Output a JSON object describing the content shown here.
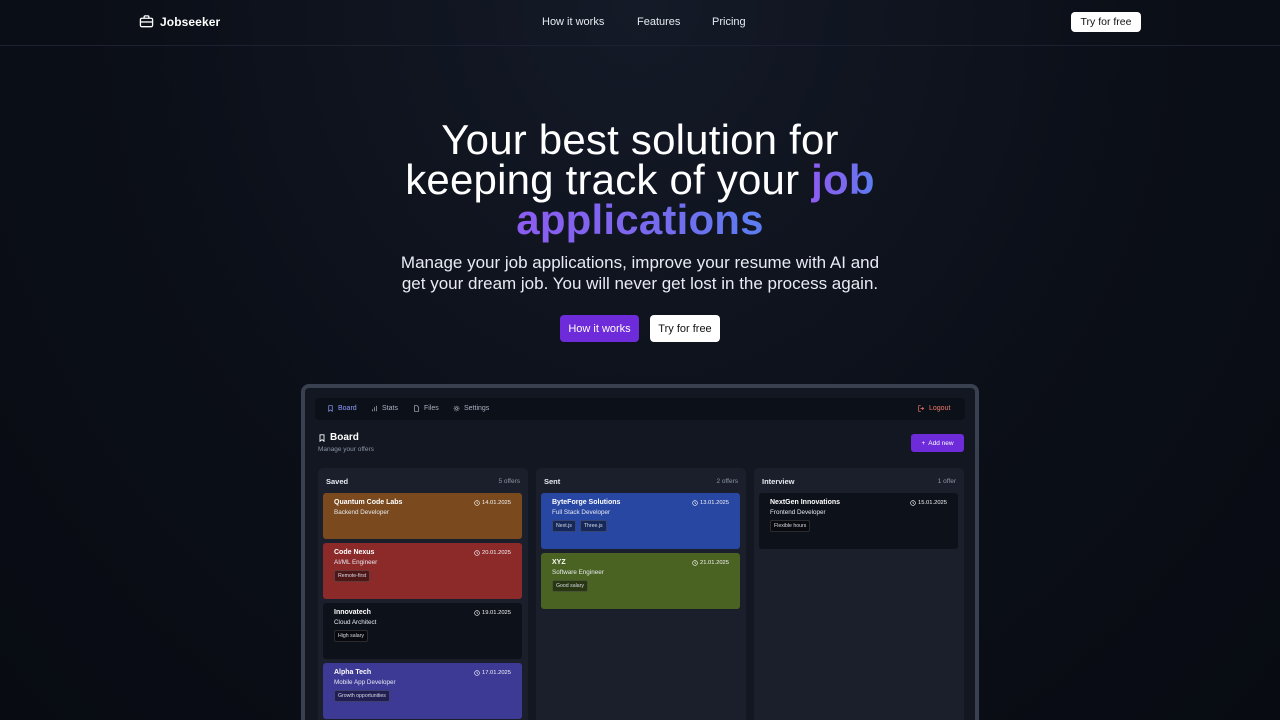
{
  "nav": {
    "brand": "Jobseeker",
    "links": [
      "How it works",
      "Features",
      "Pricing"
    ],
    "cta": "Try for free"
  },
  "hero": {
    "title_line1": "Your best solution for",
    "title_line2_plain": "keeping track of your",
    "title_line2_accent": "job",
    "title_line3_accent": "applications",
    "subtitle_line1": "Manage your job applications, improve your resume with AI and",
    "subtitle_line2": "get your dream job. You will never get lost in the process again.",
    "primary_cta": "How it works",
    "secondary_cta": "Try for free"
  },
  "app": {
    "tabs": [
      "Board",
      "Stats",
      "Files",
      "Settings"
    ],
    "logout": "Logout",
    "board_title": "Board",
    "board_subtitle": "Manage your offers",
    "add_button": "Add new",
    "columns": [
      {
        "title": "Saved",
        "count": "5 offers",
        "cards": [
          {
            "company": "Quantum Code Labs",
            "role": "Backend Developer",
            "date": "14.01.2025",
            "tags": [],
            "color": "#7a4a1e"
          },
          {
            "company": "Code Nexus",
            "role": "AI/ML Engineer",
            "date": "20.01.2025",
            "tags": [
              "Remote-first"
            ],
            "color": "#8c2a2a"
          },
          {
            "company": "Innovatech",
            "role": "Cloud Architect",
            "date": "19.01.2025",
            "tags": [
              "High salary"
            ],
            "color": "#0d111a"
          },
          {
            "company": "Alpha Tech",
            "role": "Mobile App Developer",
            "date": "17.01.2025",
            "tags": [
              "Growth opportunities"
            ],
            "color": "#3d3a95"
          }
        ]
      },
      {
        "title": "Sent",
        "count": "2 offers",
        "cards": [
          {
            "company": "ByteForge Solutions",
            "role": "Full Stack Developer",
            "date": "13.01.2025",
            "tags": [
              "Next.js",
              "Three.js"
            ],
            "color": "#2847a3"
          },
          {
            "company": "XYZ",
            "role": "Software Engineer",
            "date": "21.01.2025",
            "tags": [
              "Good salary"
            ],
            "color": "#4a6322"
          }
        ]
      },
      {
        "title": "Interview",
        "count": "1 offer",
        "cards": [
          {
            "company": "NextGen Innovations",
            "role": "Frontend Developer",
            "date": "15.01.2025",
            "tags": [
              "Flexible hours"
            ],
            "color": "#0d111a"
          }
        ]
      }
    ]
  }
}
